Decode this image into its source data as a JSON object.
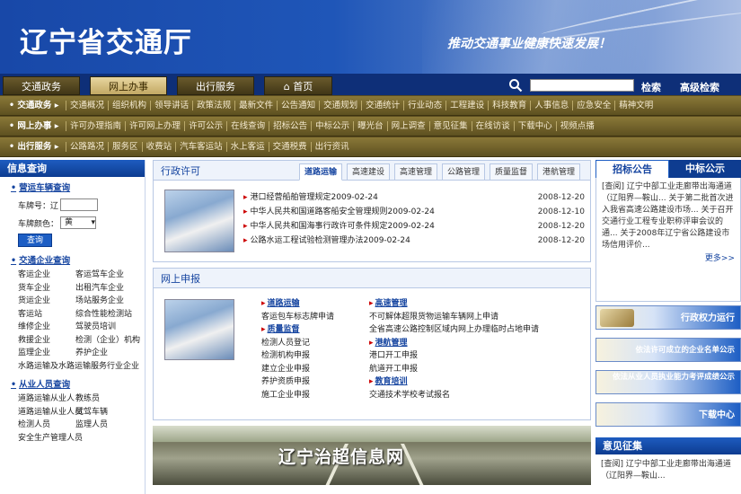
{
  "header": {
    "title": "辽宁省交通厅",
    "slogan": "推动交通事业健康快速发展！"
  },
  "nav": {
    "tabs": [
      "交通政务",
      "网上办事",
      "出行服务",
      "首页"
    ],
    "active_tab": "网上办事",
    "search_label": "检索",
    "advanced_search_label": "高级检索",
    "search_value": ""
  },
  "subnav": {
    "rows": [
      {
        "category": "交通政务",
        "items": [
          "交通概况",
          "组织机构",
          "领导讲话",
          "政策法规",
          "最新文件",
          "公告通知",
          "交通规划",
          "交通统计",
          "行业动态",
          "工程建设",
          "科技教育",
          "人事信息",
          "应急安全",
          "精神文明"
        ]
      },
      {
        "category": "网上办事",
        "items": [
          "许可办理指南",
          "许可网上办理",
          "许可公示",
          "在线查询",
          "招标公告",
          "中标公示",
          "曝光台",
          "网上调查",
          "意见征集",
          "在线访谈",
          "下载中心",
          "视频点播"
        ]
      },
      {
        "category": "出行服务",
        "items": [
          "公路路况",
          "服务区",
          "收费站",
          "汽车客运站",
          "水上客运",
          "交通税费",
          "出行资讯"
        ]
      }
    ]
  },
  "left": {
    "header": "信息查询",
    "vehicle": {
      "title": "营运车辆查询",
      "plate_label": "车牌号：辽",
      "plate_value": "",
      "color_label": "车牌颜色：",
      "color_value": "黄",
      "query_button": "查询"
    },
    "enterprise": {
      "title": "交通企业查询",
      "rows": [
        [
          "客运企业",
          "客运驾车企业"
        ],
        [
          "货车企业",
          "出租汽车企业"
        ],
        [
          "货运企业",
          "场站服务企业"
        ],
        [
          "客运站",
          "综合性能检测站"
        ],
        [
          "维修企业",
          "驾驶员培训"
        ],
        [
          "救援企业",
          "检测（企业）机构"
        ],
        [
          "监理企业",
          "养护企业"
        ]
      ],
      "last": "水路运输及水路运输服务行业企业"
    },
    "personnel": {
      "title": "从业人员查询",
      "rows": [
        [
          "道路运输从业人",
          "教练员"
        ],
        [
          "道路运输从业人员",
          "试驾车辆"
        ],
        [
          "检测人员",
          "监理人员"
        ]
      ],
      "last": "安全生产管理人员"
    }
  },
  "center": {
    "permit": {
      "title": "行政许可",
      "tabs": [
        "道路运输",
        "高速建设",
        "高速管理",
        "公路管理",
        "质量监督",
        "港航管理"
      ],
      "active_tab": "道路运输",
      "news": [
        {
          "title": "港口经营船舶管理规定2009-02-24",
          "date": "2008-12-20"
        },
        {
          "title": "中华人民共和国道路客船安全管理规则2009-02-24",
          "date": "2008-12-10"
        },
        {
          "title": "中华人民共和国海事行政许可条件规定2009-02-24",
          "date": "2008-12-20"
        },
        {
          "title": "公路水运工程试验检测管理办法2009-02-24",
          "date": "2008-12-20"
        }
      ]
    },
    "shenbao": {
      "title": "网上申报",
      "col1": [
        {
          "head": "道路运输",
          "items": [
            "客运包车标志牌申请"
          ]
        },
        {
          "head": "质量监督",
          "items": [
            "检测人员登记",
            "检测机构申报",
            "建立企业申报",
            "养护资质申报",
            "施工企业申报"
          ]
        }
      ],
      "col2": [
        {
          "head": "高速管理",
          "items": [
            "不可解体超限货物运输车辆网上申请",
            "全省高速公路控制区域内网上办理临时占地申请"
          ]
        },
        {
          "head": "港航管理",
          "items": [
            "港口开工申报",
            "航道开工申报"
          ]
        },
        {
          "head": "教育培训",
          "items": [
            "交通技术学校考试报名"
          ]
        }
      ]
    },
    "banner_title": "辽宁治超信息网"
  },
  "right": {
    "tabs": [
      "招标公告",
      "中标公示"
    ],
    "active_tab": "招标公告",
    "notice": "[查阅] 辽宁中部工业走廊带出海通道（辽阳界—鞍山... 关于第二批首次进入我省高速公路建设市场... 关于召开交通行业工程专业职称评审会议的通... 关于2008年辽宁省公路建设市场信用评价...",
    "more": "更多>>",
    "buttons": [
      "行政权力运行",
      "依法许可成立的企业名单公示",
      "依法从业人员执业能力考评成绩公示",
      "下载中心"
    ],
    "opinion_title": "意见征集",
    "opinion_text": "[查阅] 辽宁中部工业走廊带出海通道（辽阳界—鞍山..."
  }
}
